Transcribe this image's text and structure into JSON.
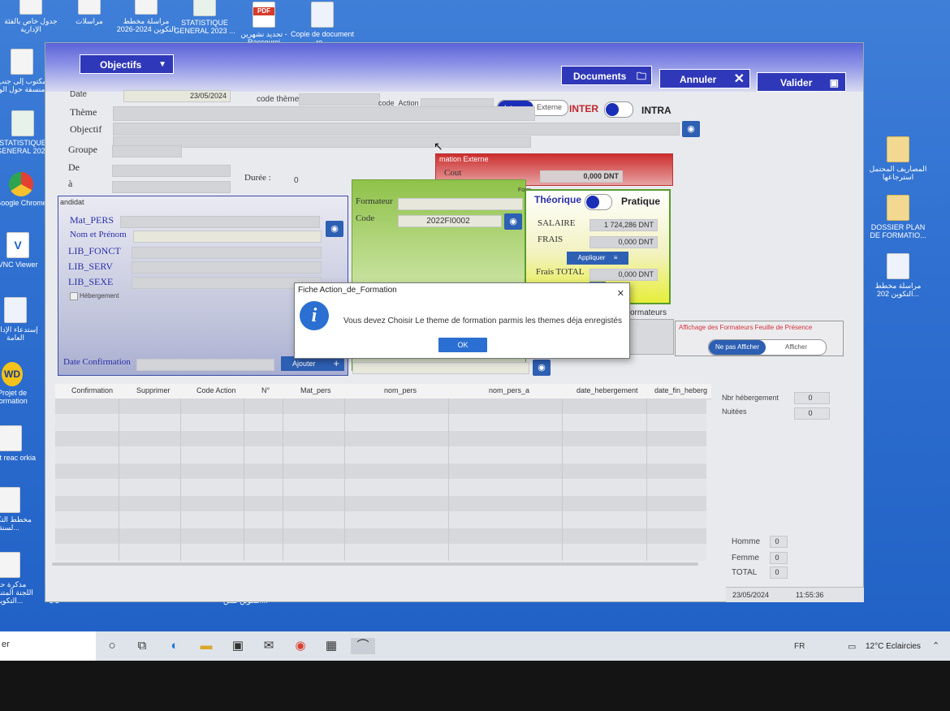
{
  "desktop": {
    "icons": [
      {
        "label": "جدول خاص بالفئة الإدارية",
        "icon": "doc-icon"
      },
      {
        "label": "مراسلات",
        "icon": "doc-icon"
      },
      {
        "label": "مراسلة مخطط التكوين 2024-2026",
        "icon": "doc-icon"
      },
      {
        "label": "STATISTIQUE GENERAL 2023 ...",
        "icon": "excel-icon"
      },
      {
        "label": "تحديد نشهرين - Raccourci",
        "icon": "pdf-icon"
      },
      {
        "label": "Copie de document re...",
        "icon": "word-icon"
      },
      {
        "label": "مكتوب إلى جنب منسقة حول الو",
        "icon": "doc-icon"
      },
      {
        "label": "STATISTIQUE GENERAL 2021",
        "icon": "excel-icon"
      },
      {
        "label": "Google Chrome",
        "icon": "chrome-icon"
      },
      {
        "label": "VNC Viewer",
        "icon": "vnc-icon"
      },
      {
        "label": "إستدعاء الإدارة العامة",
        "icon": "word-icon"
      },
      {
        "label": "Projet de formation",
        "icon": "wd-icon"
      },
      {
        "label": "ment reac orkia",
        "icon": "doc-icon"
      },
      {
        "label": "مخطط التكوين لسنة...",
        "icon": "doc-icon"
      },
      {
        "label": "مذكرة حول اللجنة المتناصفة التكوين...",
        "icon": "doc-icon"
      },
      {
        "label": "مخطط التكوين...",
        "icon": "doc-icon"
      },
      {
        "label": "التكوين لسن...",
        "icon": "doc-icon"
      },
      {
        "label": "المصاريف المحتمل استرجاعها",
        "icon": "folder-icon"
      },
      {
        "label": "DOSSIER PLAN DE FORMATIO...",
        "icon": "folder-icon"
      },
      {
        "label": "مراسلة مخطط التكوين 202...",
        "icon": "word-icon"
      }
    ]
  },
  "app": {
    "objectifs_label": "Objectifs",
    "documents_label": "Documents",
    "annuler_label": "Annuler",
    "valider_label": "Valider",
    "date_label": "Date",
    "date_value": "23/05/2024",
    "code_theme_label": "code thème",
    "code_action_label": "code_Action",
    "interne_label": "Interne",
    "externe_label": "Externe",
    "inter_label": "INTER",
    "intra_label": "INTRA",
    "theme_label": "Thème",
    "objectif_label": "Objectif",
    "groupe_label": "Groupe",
    "de_label": "De",
    "a_label": "à",
    "duree_label": "Durée :",
    "duree_value": "0",
    "formation_externe_label": "mation Externe",
    "cout_label": "Cout",
    "cout_value": "0,000 DNT",
    "candidat_label": "andidat",
    "mat_pers_label": "Mat_PERS",
    "nom_prenom_label": "Nom et Prénom",
    "lib_fonct_label": "LIB_FONCT",
    "lib_serv_label": "LIB_SERV",
    "lib_sexe_label": "LIB_SEXE",
    "hebergement_label": "Hébergement",
    "date_confirmation_label": "Date Confirmation",
    "ajouter_label": "Ajouter",
    "formateur_label": "Formateur",
    "code_label": "Code",
    "code_value": "2022FI0002",
    "form_tag": "Form",
    "theorique_label": "Théorique",
    "pratique_label": "Pratique",
    "salaire_label": "SALAIRE",
    "salaire_value": "1 724,286 DNT",
    "frais_label": "FRAIS",
    "frais_value": "0,000 DNT",
    "appliquer_label": "Appliquer",
    "frais_total_label": "Frais TOTAL",
    "frais_total_value": "0,000 DNT",
    "formateurs_label": "ormateurs",
    "affichage_label": "Affichage des Formateurs Feuille de Présence",
    "ne_pas_afficher_label": "Ne pas Afficher",
    "afficher_label": "Afficher",
    "grid_columns": [
      "Confirmation",
      "Supprimer",
      "Code Action",
      "N°",
      "Mat_pers",
      "nom_pers",
      "nom_pers_a",
      "date_hebergement",
      "date_fin_heberg"
    ],
    "nbr_hebergement_label": "Nbr hébergement",
    "nbr_hebergement_value": "0",
    "nuitees_label": "Nuitées",
    "nuitees_value": "0",
    "homme_label": "Homme",
    "homme_value": "0",
    "femme_label": "Femme",
    "femme_value": "0",
    "total_label": "TOTAL",
    "total_value": "0",
    "status_date": "23/05/2024",
    "status_time": "11:55:36"
  },
  "dialog": {
    "title": "Fiche Action_de_Formation",
    "message": "Vous devez Choisir Le theme de formation parmis les themes déja enregistés",
    "ok_label": "OK",
    "close_glyph": "✕",
    "info_glyph": "i"
  },
  "taskbar": {
    "search_text": "er",
    "language": "FR",
    "weather": "12°C  Eclaircies"
  }
}
